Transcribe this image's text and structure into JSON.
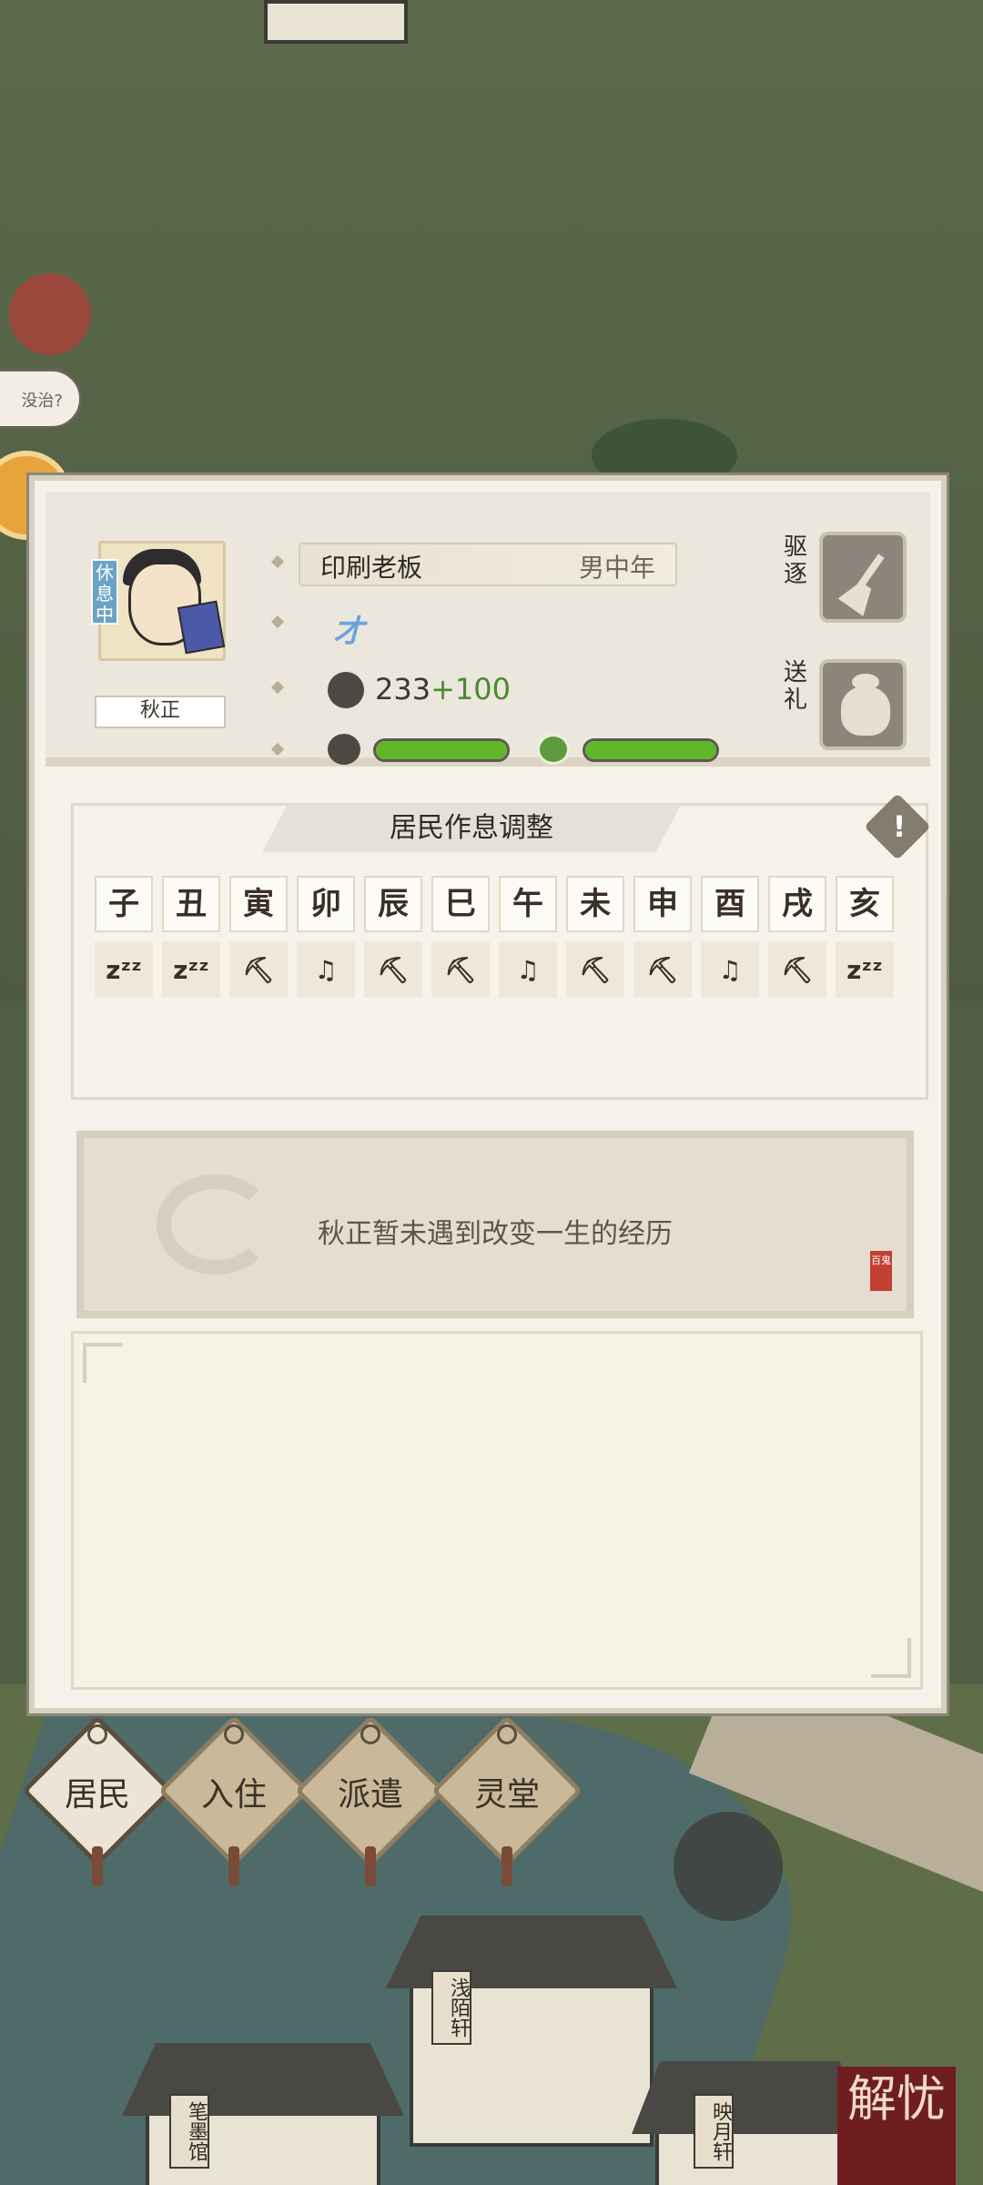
{
  "world": {
    "bubble_text": "没治?",
    "building_signs": [
      "浅陌轩",
      "笔墨馆",
      "映月轩"
    ],
    "corner_seal": "解忧"
  },
  "resident": {
    "status_tag": "休息中",
    "name": "秋正",
    "job": "印刷老板",
    "tag": "男中年",
    "talent": "才",
    "stat_base": "233",
    "stat_bonus": "+100",
    "mood_level": 1.0,
    "health_level": 1.0
  },
  "actions": {
    "expel_label": "驱逐",
    "gift_label": "送礼"
  },
  "schedule": {
    "title": "居民作息调整",
    "hours": [
      "子",
      "丑",
      "寅",
      "卯",
      "辰",
      "巳",
      "午",
      "未",
      "申",
      "酉",
      "戌",
      "亥"
    ],
    "activities": [
      "sleep",
      "sleep",
      "work",
      "leisure",
      "work",
      "work",
      "leisure",
      "work",
      "work",
      "leisure",
      "work",
      "sleep"
    ],
    "activity_icons": {
      "sleep": "sleep-icon",
      "work": "pickaxe-icon",
      "leisure": "music-person-icon"
    }
  },
  "fate": {
    "text": "秋正暂未遇到改变一生的经历",
    "seal": "百鬼"
  },
  "nav": {
    "items": [
      "居民",
      "入住",
      "派遣",
      "灵堂"
    ],
    "active": "居民"
  }
}
